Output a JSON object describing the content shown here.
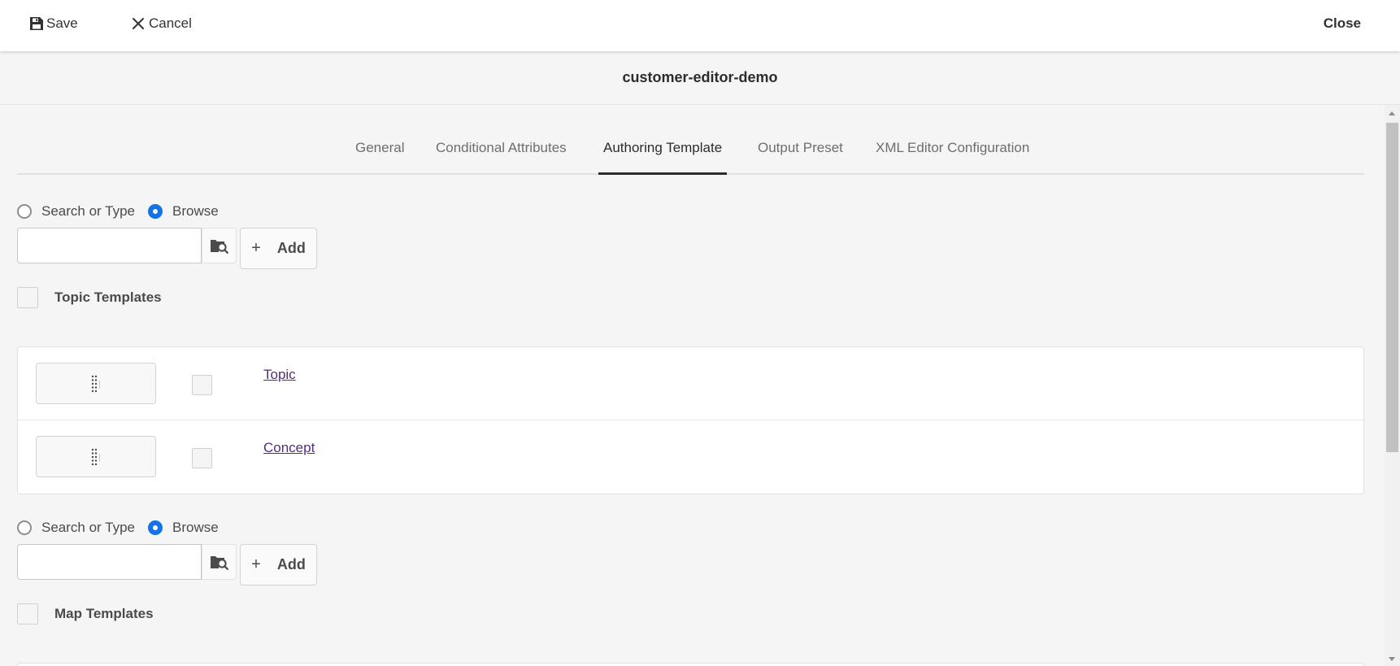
{
  "toolbar": {
    "save_label": "Save",
    "cancel_label": "Cancel",
    "close_label": "Close"
  },
  "page": {
    "title": "customer-editor-demo"
  },
  "tabs": [
    {
      "label": "General",
      "active": false
    },
    {
      "label": "Conditional Attributes",
      "active": false
    },
    {
      "label": "Authoring Template",
      "active": true
    },
    {
      "label": "Output Preset",
      "active": false
    },
    {
      "label": "XML Editor Configuration",
      "active": false
    }
  ],
  "topic_section": {
    "mode_options": [
      "Search or Type",
      "Browse"
    ],
    "selected_mode": "Browse",
    "path_value": "",
    "add_label": "Add",
    "header_label": "Topic Templates",
    "templates": [
      {
        "name": "Topic"
      },
      {
        "name": "Concept"
      }
    ]
  },
  "map_section": {
    "mode_options": [
      "Search or Type",
      "Browse"
    ],
    "selected_mode": "Browse",
    "path_value": "",
    "add_label": "Add",
    "header_label": "Map Templates"
  },
  "colors": {
    "accent": "#1473e6",
    "link": "#5a2a82"
  }
}
